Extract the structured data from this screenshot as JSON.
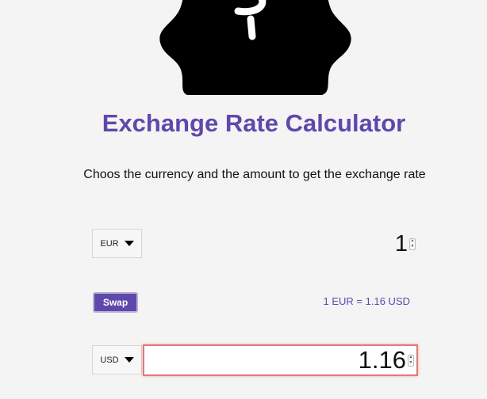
{
  "app": {
    "title": "Exchange Rate Calculator",
    "subtitle": "Choos the currency and the amount to get the exchange rate",
    "logo": "money-badge-icon",
    "accent_color": "#5f48ab"
  },
  "currency_one": {
    "selected": "EUR",
    "amount": "1"
  },
  "currency_two": {
    "selected": "USD",
    "amount": "1.16"
  },
  "swap": {
    "label": "Swap"
  },
  "rate": {
    "text": "1 EUR = 1.16 USD"
  },
  "icons": {
    "logo": "dollar-badge-icon",
    "dropdown": "caret-down-icon",
    "spinner": "number-spinner-icon"
  }
}
